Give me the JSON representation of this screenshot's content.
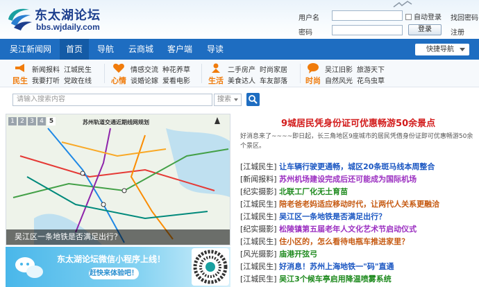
{
  "site": {
    "logo_title": "东太湖论坛",
    "logo_url": "bbs.wjdaily.com"
  },
  "login": {
    "username_label": "用户名",
    "password_label": "密码",
    "remember_label": "自动登录",
    "forgot_label": "找回密码",
    "login_button": "登录",
    "register_label": "注册"
  },
  "nav": {
    "items": [
      "吴江新闻网",
      "首页",
      "导航",
      "云商城",
      "客户端",
      "导读"
    ],
    "active_index": 1,
    "quick_nav": "快捷导航"
  },
  "categories": [
    {
      "name": "民生",
      "icon": "megaphone-icon",
      "links": [
        "新闻报料",
        "江城民生",
        "我要打听",
        "党政在线"
      ]
    },
    {
      "name": "心情",
      "icon": "heart-icon",
      "links": [
        "情感交流",
        "种花养草",
        "谈婚论嫁",
        "爱看电影"
      ]
    },
    {
      "name": "生活",
      "icon": "lifestyle-icon",
      "links": [
        "二手房产",
        "时尚家居",
        "美食达人",
        "车友部落"
      ]
    },
    {
      "name": "时尚",
      "icon": "chat-bubble-icon",
      "links": [
        "吴江旧影",
        "旅游天下",
        "自然风光",
        "花鸟虫草"
      ]
    }
  ],
  "search": {
    "placeholder": "请输入搜索内容",
    "scope": "搜索"
  },
  "slideshow": {
    "tabs": [
      "1",
      "2",
      "3",
      "4",
      "5"
    ],
    "active_tab": 4,
    "map_title": "苏州轨道交通近期线网规划",
    "caption": "吴江区一条地铁是否满足出行？"
  },
  "banner": {
    "title": "东太湖论坛微信小程序上线！",
    "button": "赶快来体验吧！"
  },
  "headline": {
    "title": "9城居民凭身份证可优惠畅游50余景点",
    "description": "好消息来了~~~~即日起，长三角地区9座城市的居民凭借身份证即可优惠畅游50余个景区。"
  },
  "news": [
    {
      "tag": "[江城民生]",
      "title": "让车辆行驶更通畅，城区20条斑马线本周整合",
      "color": "#1a56c2"
    },
    {
      "tag": "[新闻报料]",
      "title": "苏州机场建设完成后还可能成为国际机场",
      "color": "#9b2fc1"
    },
    {
      "tag": "[纪实摄影]",
      "title": "北联工厂化无土育苗",
      "color": "#1e8a1e"
    },
    {
      "tag": "[江城民生]",
      "title": "陪老爸老妈适应移动时代，让两代人关系更融洽",
      "color": "#c65a12"
    },
    {
      "tag": "[江城民生]",
      "title": "吴江区一条地铁是否满足出行？",
      "color": "#1a56c2"
    },
    {
      "tag": "[纪实摄影]",
      "title": "松陵镇第五届老年人文化艺术节启动仪式",
      "color": "#9b2fc1"
    },
    {
      "tag": "[江城民生]",
      "title": "住小区的，怎么看待电瓶车推进家里？",
      "color": "#c65a12"
    },
    {
      "tag": "[风光摄影]",
      "title": "庙港开弦弓",
      "color": "#1e8a1e"
    },
    {
      "tag": "[江城民生]",
      "title": "好消息！苏州上海地铁一\"码\"直通",
      "color": "#1a56c2"
    },
    {
      "tag": "[江城民生]",
      "title": "吴江3个候车亭启用降温喷雾系统",
      "color": "#1e8a1e"
    }
  ],
  "colors": {
    "nav_blue": "#1e6dc1",
    "category_orange": "#f07c0c",
    "headline_red": "#d21a1a"
  }
}
